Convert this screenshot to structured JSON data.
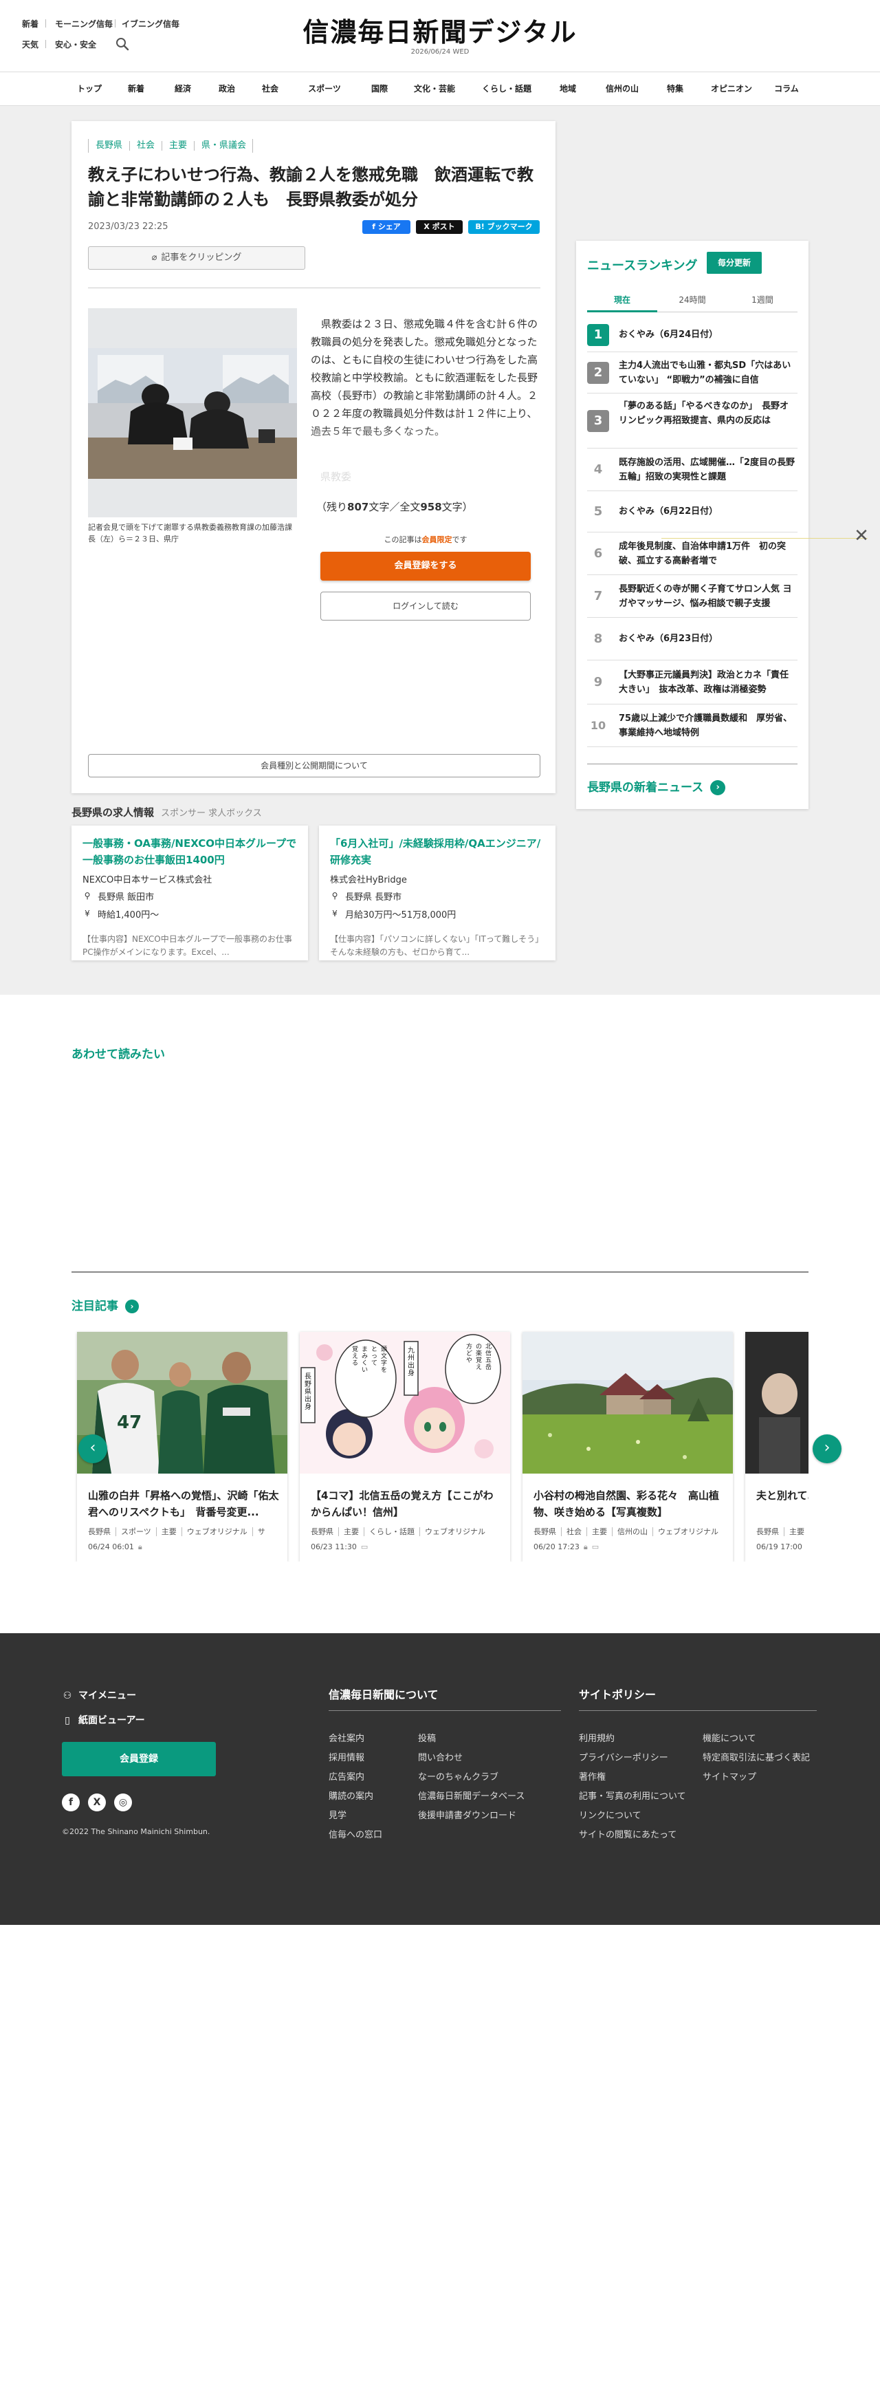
{
  "header": {
    "links_row1": [
      "新着",
      "モーニング信毎",
      "イブニング信毎"
    ],
    "links_row2": [
      "天気",
      "安心・安全"
    ],
    "logo": "信濃毎日新聞デジタル",
    "date": "2026/06/24 WED"
  },
  "nav": [
    "トップ",
    "新着",
    "経済",
    "政治",
    "社会",
    "スポーツ",
    "国際",
    "文化・芸能",
    "くらし・話題",
    "地域",
    "信州の山",
    "特集",
    "オピニオン",
    "コラム"
  ],
  "article": {
    "breadcrumbs": [
      "長野県",
      "社会",
      "主要",
      "県・県議会"
    ],
    "title": "教え子にわいせつ行為、教諭２人を懲戒免職　飲酒運転で教諭と非常勤講師の２人も　長野県教委が処分",
    "date": "2023/03/23 22:25",
    "share": {
      "facebook": "シェア",
      "x": "ポスト",
      "hatena": "ブックマーク"
    },
    "clip_label": "記事をクリッピング",
    "caption": "記者会見で頭を下げて謝罪する県教委義務教育課の加藤浩課長（左）ら＝２３日、県庁",
    "body": "県教委は２３日、懲戒免職４件を含む計６件の教職員の処分を発表した。懲戒免職処分となったのは、ともに自校の生徒にわいせつ行為をした高校教諭と中学校教諭。ともに飲酒運転をした長野高校（長野市）の教諭と非常勤講師の計４人。２０２２年度の教職員処分件数は計１２件に上り、過去５年で最も多くなった。",
    "fade_word": "県教委",
    "counts_prefix": "（残り",
    "remaining": "807",
    "counts_mid": "文字／全文",
    "total": "958",
    "counts_suffix": "文字）",
    "limited_prefix": "この記事は",
    "limited_highlight": "会員限定",
    "limited_suffix": "です",
    "register_label": "会員登録をする",
    "login_label": "ログインして読む",
    "plans_label": "会員種別と公開期間について"
  },
  "jobs": {
    "heading": "長野県の求人情報",
    "sponsor": "スポンサー 求人ボックス",
    "items": [
      {
        "title": "一般事務・OA事務/NEXCO中日本グループで一般事務のお仕事飯田1400円",
        "company": "NEXCO中日本サービス株式会社",
        "location": "長野県 飯田市",
        "pay": "時給1,400円～",
        "desc": "【仕事内容】NEXCO中日本グループで一般事務のお仕事PC操作がメインになります。Excel、..."
      },
      {
        "title": "「6月入社可」/未経験採用枠/QAエンジニア/研修充実",
        "company": "株式会社HyBridge",
        "location": "長野県 長野市",
        "pay": "月給30万円～51万8,000円",
        "desc": "【仕事内容】「パソコンに詳しくない」「ITって難しそう」そんな未経験の方も、ゼロから育て..."
      }
    ]
  },
  "ranking": {
    "heading": "ニュースランキング",
    "badge": "毎分更新",
    "tabs": [
      "現在",
      "24時間",
      "1週間"
    ],
    "items": [
      {
        "rank": "1",
        "title": "おくやみ（6月24日付）"
      },
      {
        "rank": "2",
        "title": "主力4人流出でも山雅・都丸SD「穴はあいていない」 “即戦力”の補強に自信"
      },
      {
        "rank": "3",
        "title": "「夢のある話」「やるべきなのか」　長野オリンピック再招致提言、県内の反応は"
      },
      {
        "rank": "4",
        "title": "既存施設の活用、広域開催…「2度目の長野五輪」招致の実現性と課題"
      },
      {
        "rank": "5",
        "title": "おくやみ（6月22日付）"
      },
      {
        "rank": "6",
        "title": "成年後見制度、自治体申請1万件　初の突破、孤立する高齢者増で"
      },
      {
        "rank": "7",
        "title": "長野駅近くの寺が開く子育てサロン人気 ヨガやマッサージ、悩み相談で親子支援"
      },
      {
        "rank": "8",
        "title": "おくやみ（6月23日付）"
      },
      {
        "rank": "9",
        "title": "【大野事正元議員判決】政治とカネ「責任大きい」　抜本改革、政権は消極姿勢"
      },
      {
        "rank": "10",
        "title": "75歳以上減少で介護職員数緩和　厚労省、事業維持へ地域特例"
      }
    ],
    "more_label": "長野県の新着ニュース"
  },
  "also_read": {
    "heading": "あわせて読みたい"
  },
  "featured": {
    "heading": "注目記事",
    "cards": [
      {
        "title": "山雅の白井「昇格への覚悟」、沢崎「佑太君へのリスペクトも」　背番号変更...",
        "tags": [
          "長野県",
          "スポーツ",
          "主要",
          "ウェブオリジナル",
          "サ"
        ],
        "date": "06/24 06:01"
      },
      {
        "title": "【4コマ】北信五岳の覚え方【ここがわからんぱい！信州】",
        "tags": [
          "長野県",
          "主要",
          "くらし・話題",
          "ウェブオリジナル"
        ],
        "date": "06/23 11:30",
        "comic_text": [
          "長野県出身",
          "九州出身",
          "北信五岳の楽覚え方どや",
          "頭文字をとって「まみくいと」って覚えるんだよ！"
        ]
      },
      {
        "title": "小谷村の栂池自然園、彩る花々　高山植物、咲き始める【写真複数】",
        "tags": [
          "長野県",
          "社会",
          "主要",
          "信州の山",
          "ウェブオリジナル"
        ],
        "date": "06/20 17:23"
      },
      {
        "title": "夫と別れて…は　交錯し...",
        "tags": [
          "長野県",
          "主要"
        ],
        "date": "06/19 17:00"
      }
    ]
  },
  "footer": {
    "mymenu": "マイメニュー",
    "viewer": "紙面ビューアー",
    "register": "会員登録",
    "social": [
      "f",
      "X",
      "◎"
    ],
    "copyright": "©2022 The Shinano Mainichi Shimbun.",
    "about_heading": "信濃毎日新聞について",
    "about_col1": [
      "会社案内",
      "採用情報",
      "広告案内",
      "購読の案内",
      "見学",
      "信毎への窓口"
    ],
    "about_col2": [
      "投稿",
      "問い合わせ",
      "なーのちゃんクラブ",
      "信濃毎日新聞データベース",
      "後援申請書ダウンロード"
    ],
    "policy_heading": "サイトポリシー",
    "policy_col1": [
      "利用規約",
      "プライバシーポリシー",
      "著作権",
      "記事・写真の利用について",
      "リンクについて",
      "サイトの閲覧にあたって"
    ],
    "policy_col2": [
      "機能について",
      "特定商取引法に基づく表記",
      "サイトマップ"
    ]
  },
  "colors": {
    "accent": "#0a9a7f",
    "cta": "#e8600a",
    "footer_bg": "#333333"
  }
}
